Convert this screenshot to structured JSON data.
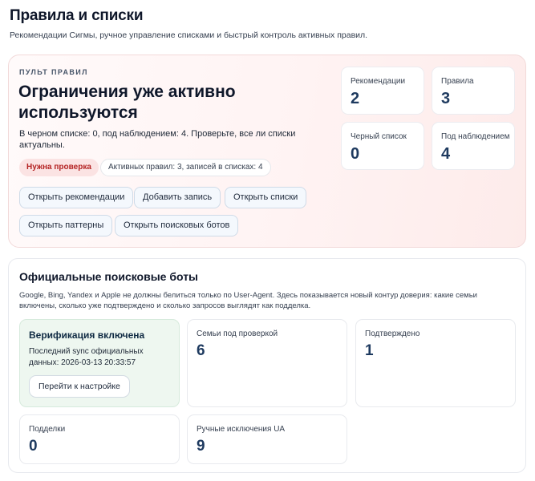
{
  "header": {
    "title": "Правила и списки",
    "subtitle": "Рекомендации Сигмы, ручное управление списками и быстрый контроль активных правил."
  },
  "console": {
    "eyebrow": "ПУЛЬТ ПРАВИЛ",
    "headline": "Ограничения уже активно используются",
    "description": "В черном списке: 0, под наблюдением: 4. Проверьте, все ли списки актуальны.",
    "warning_badge": "Нужна проверка",
    "info_badge": "Активных правил: 3, записей в списках: 4",
    "buttons": {
      "recommendations": "Открыть рекомендации",
      "add_entry": "Добавить запись",
      "lists": "Открыть списки",
      "patterns": "Открыть паттерны",
      "search_bots": "Открыть поисковых ботов"
    },
    "stats": [
      {
        "label": "Рекомендации",
        "value": "2"
      },
      {
        "label": "Правила",
        "value": "3"
      },
      {
        "label": "Черный список",
        "value": "0"
      },
      {
        "label": "Под наблюдением",
        "value": "4"
      }
    ]
  },
  "bots": {
    "title": "Официальные поисковые боты",
    "description": "Google, Bing, Yandex и Apple не должны белиться только по User-Agent. Здесь показывается новый контур доверия: какие семьи включены, сколько уже подтверждено и сколько запросов выглядят как подделка.",
    "verification": {
      "title": "Верификация включена",
      "text": "Последний sync официальных данных: 2026-03-13 20:33:57",
      "button": "Перейти к настройке"
    },
    "stats": [
      {
        "label": "Семьи под проверкой",
        "value": "6"
      },
      {
        "label": "Подтверждено",
        "value": "1"
      },
      {
        "label": "Подделки",
        "value": "0"
      },
      {
        "label": "Ручные исключения UA",
        "value": "9"
      }
    ]
  }
}
